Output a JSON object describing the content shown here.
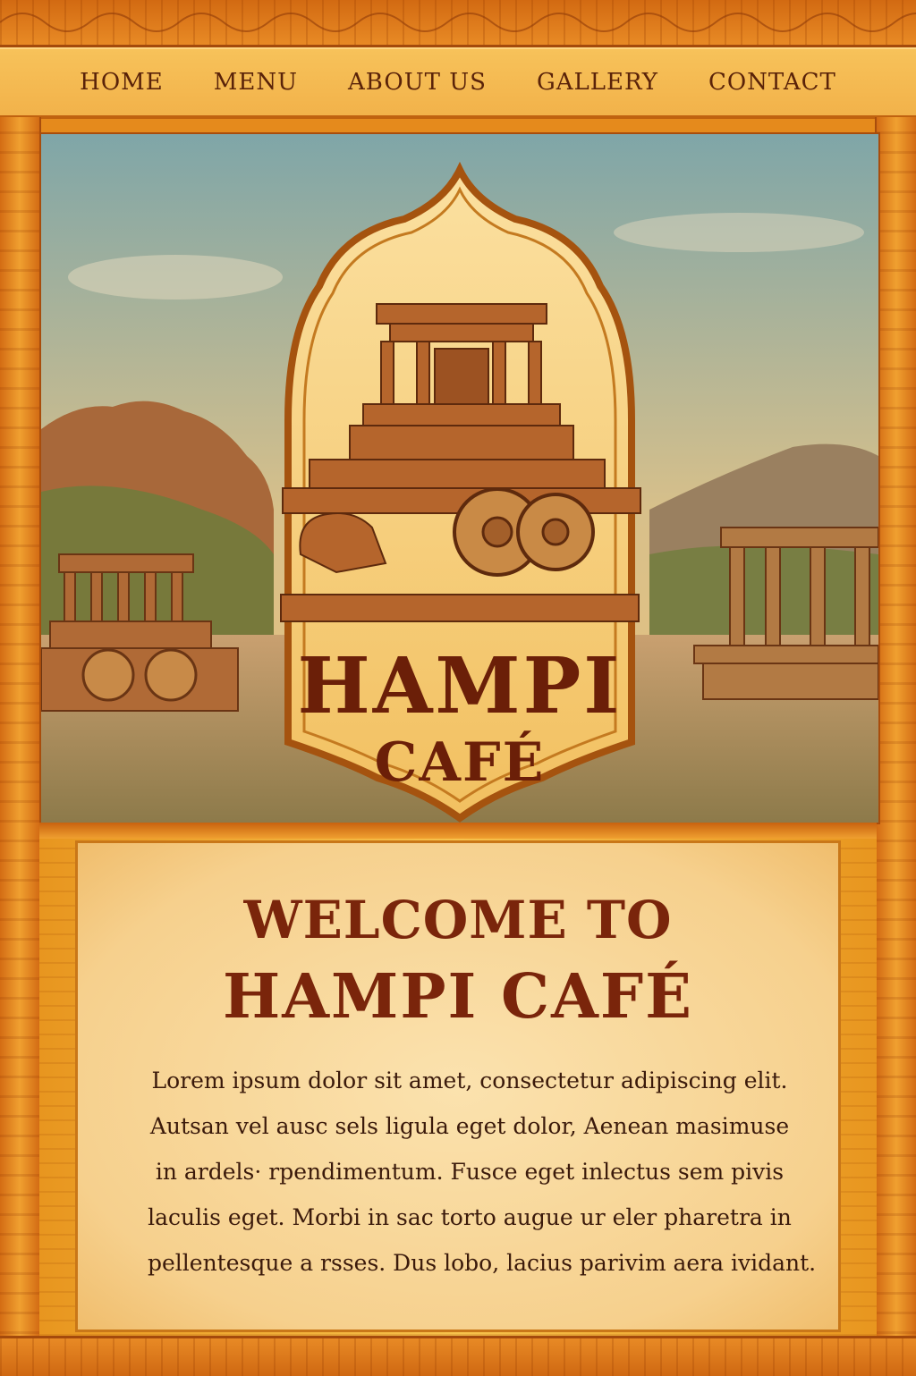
{
  "nav": {
    "items": [
      {
        "label": "HOME"
      },
      {
        "label": "MENU"
      },
      {
        "label": "ABOUT US"
      },
      {
        "label": "GALLERY"
      },
      {
        "label": "CONTACT"
      }
    ]
  },
  "hero": {
    "logo_title": "HAMPI",
    "logo_subtitle": "CAFÉ"
  },
  "welcome": {
    "heading_line1": "WELCOME TO",
    "heading_line2": "HAMPI CAFÉ",
    "paragraph_lines": [
      "Lorem ipsum dolor sit amet, consectetur adipiscing elit.",
      "Autsan vel ausc sels ligula eget dolor, Aenean masimuse",
      "in ardels· rpendimentum. Fusce eget inlectus sem pivis",
      "laculis eget. Morbi in sac torto augue ur eler pharetra in",
      "pellentesque a rsses. Dus lobo, lacius parivim aera ividant."
    ]
  },
  "colors": {
    "frame_orange": "#e58a1c",
    "nav_gold": "#f7c25a",
    "heading_maroon": "#7a250b",
    "panel_cream": "#fbe2ae"
  }
}
